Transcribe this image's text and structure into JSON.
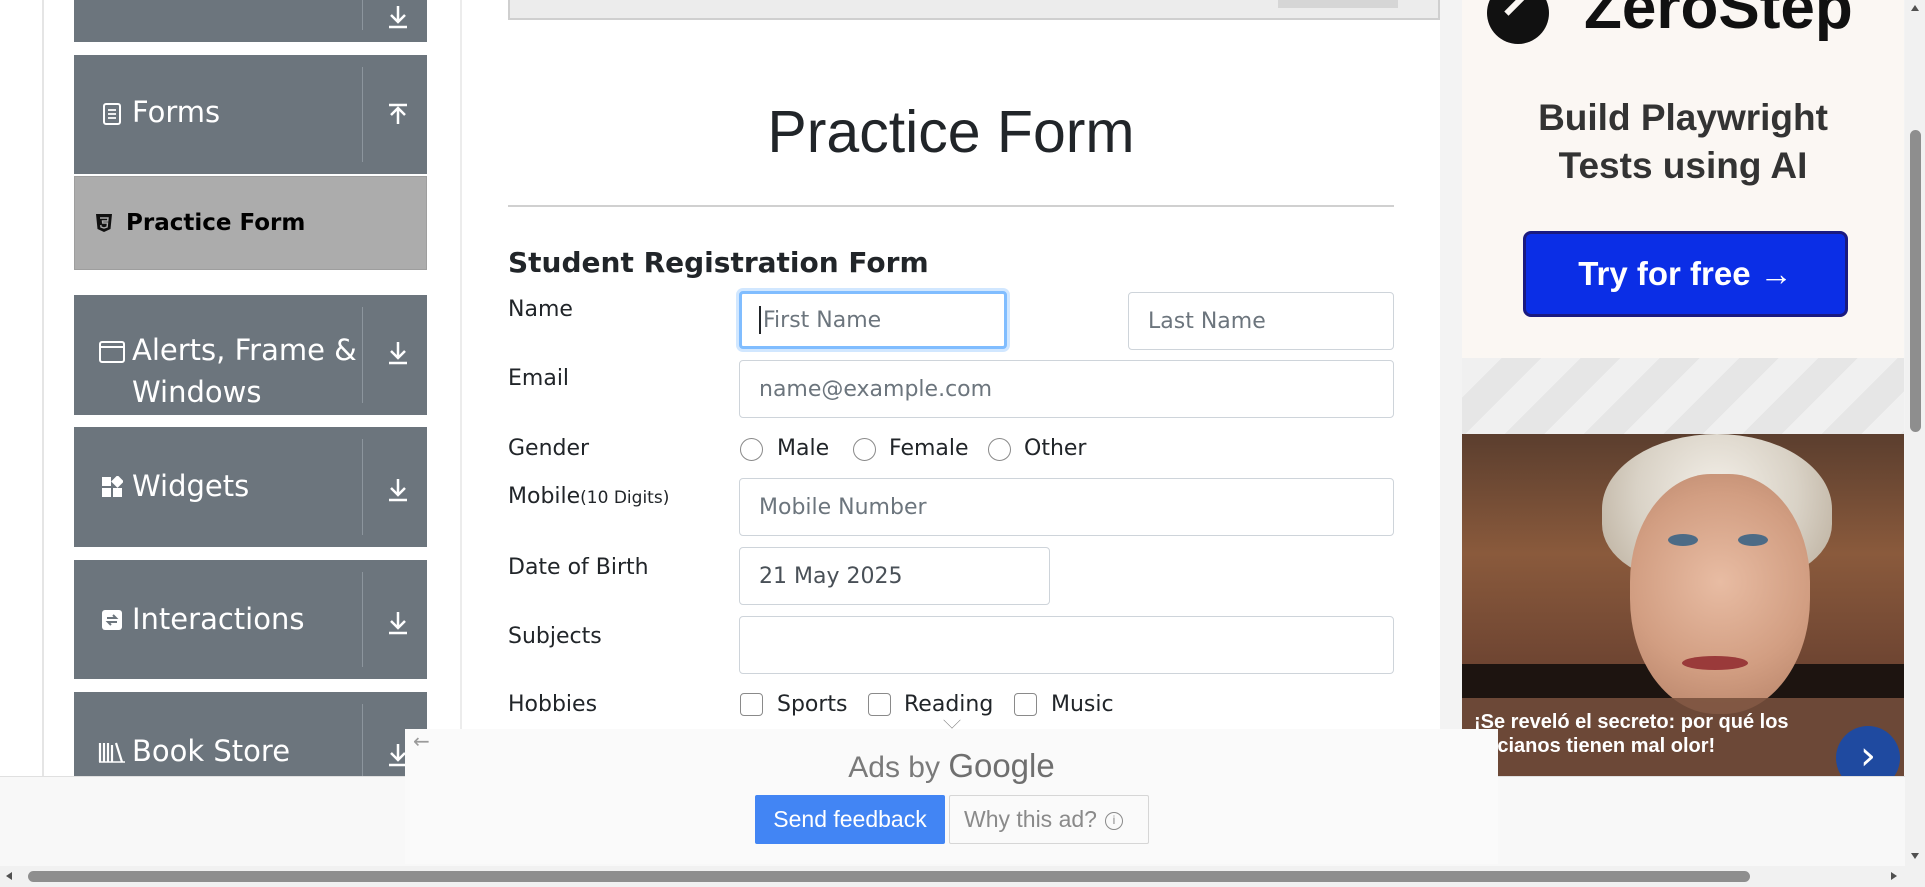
{
  "sidebar": {
    "groups": [
      {
        "label": "Forms",
        "icon": "document-icon",
        "arrow": "collapse-arrow-icon"
      },
      {
        "label": "Alerts, Frame &",
        "label2": "Windows",
        "icon": "window-icon",
        "arrow": "expand-arrow-icon"
      },
      {
        "label": "Widgets",
        "icon": "widgets-icon",
        "arrow": "expand-arrow-icon"
      },
      {
        "label": "Interactions",
        "icon": "interactions-icon",
        "arrow": "expand-arrow-icon"
      },
      {
        "label": "Book Store",
        "icon": "books-icon",
        "arrow": "expand-arrow-icon"
      }
    ],
    "active_item": {
      "label": "Practice Form",
      "icon": "html5-icon"
    }
  },
  "main": {
    "title": "Practice Form",
    "form_heading": "Student Registration Form",
    "labels": {
      "name": "Name",
      "email": "Email",
      "gender": "Gender",
      "mobile": "Mobile",
      "mobile_hint": "(10 Digits)",
      "dob": "Date of Birth",
      "subjects": "Subjects",
      "hobbies": "Hobbies"
    },
    "placeholders": {
      "first_name": "First Name",
      "last_name": "Last Name",
      "email": "name@example.com",
      "mobile": "Mobile Number"
    },
    "values": {
      "dob": "21 May 2025",
      "subjects": ""
    },
    "gender_options": [
      "Male",
      "Female",
      "Other"
    ],
    "hobby_options": [
      "Sports",
      "Reading",
      "Music"
    ]
  },
  "ads": {
    "brand": "ZeroStep",
    "headline_line1": "Build Playwright",
    "headline_line2": "Tests using AI",
    "cta": "Try for free →",
    "caption": "¡Se reveló el secreto: por qué los ancianos tienen mal olor!",
    "google": {
      "ads_by": "Ads by",
      "google_word": "Google",
      "send_feedback": "Send feedback",
      "why_this_ad": "Why this ad?"
    }
  },
  "colors": {
    "sidebar_tile": "#6c757d",
    "active_item": "#acacac",
    "focus_ring": "#80bdff",
    "ad_cta": "#0b2ee6",
    "google_blue": "#4285f4"
  }
}
